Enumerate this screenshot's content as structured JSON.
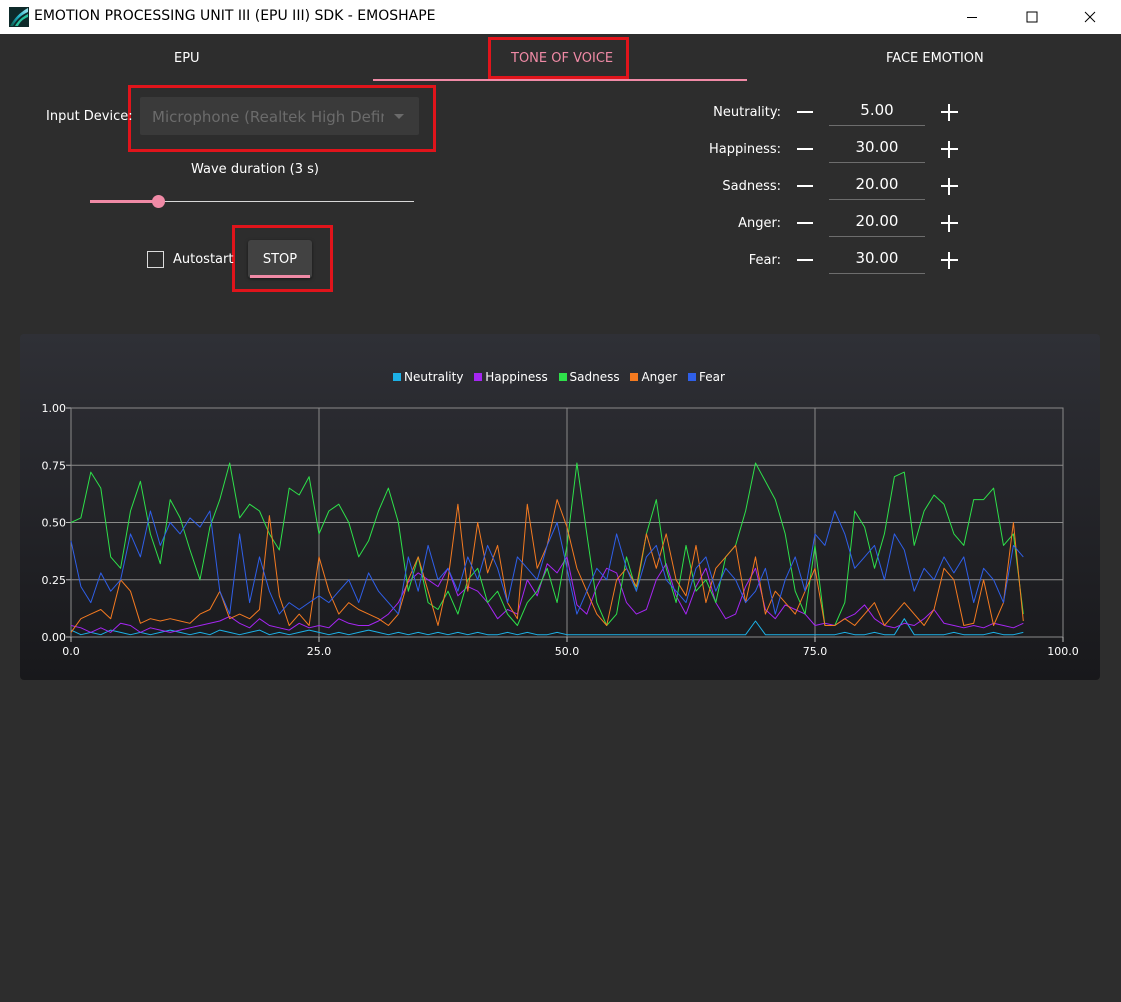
{
  "window": {
    "title": "EMOTION PROCESSING UNIT III (EPU III) SDK - EMOSHAPE"
  },
  "tabs": [
    {
      "label": "EPU",
      "active": false
    },
    {
      "label": "TONE OF VOICE",
      "active": true
    },
    {
      "label": "FACE EMOTION",
      "active": false
    }
  ],
  "controls": {
    "input_device_label": "Input Device:",
    "input_device_value": "Microphone (Realtek High Definition Audio)",
    "wave_duration_label": "Wave duration (3 s)",
    "wave_duration_fraction": 0.21,
    "autostart_label": "Autostart",
    "autostart_checked": false,
    "stop_label": "STOP"
  },
  "emotions": [
    {
      "label": "Neutrality:",
      "value": "5.00"
    },
    {
      "label": "Happiness:",
      "value": "30.00"
    },
    {
      "label": "Sadness:",
      "value": "20.00"
    },
    {
      "label": "Anger:",
      "value": "20.00"
    },
    {
      "label": "Fear:",
      "value": "30.00"
    }
  ],
  "colors": {
    "accent": "#f08aa6",
    "highlight_box": "#e0141b",
    "background": "#2d2d2d"
  },
  "chart_data": {
    "type": "line",
    "title": "",
    "xlabel": "",
    "ylabel": "",
    "xlim": [
      0,
      100
    ],
    "ylim": [
      0,
      1
    ],
    "x_ticks": [
      "0.0",
      "25.0",
      "50.0",
      "75.0",
      "100.0"
    ],
    "y_ticks": [
      "0.00",
      "0.25",
      "0.50",
      "0.75",
      "1.00"
    ],
    "grid": true,
    "legend_position": "top-center",
    "x": [
      0,
      1,
      2,
      3,
      4,
      5,
      6,
      7,
      8,
      9,
      10,
      11,
      12,
      13,
      14,
      15,
      16,
      17,
      18,
      19,
      20,
      21,
      22,
      23,
      24,
      25,
      26,
      27,
      28,
      29,
      30,
      31,
      32,
      33,
      34,
      35,
      36,
      37,
      38,
      39,
      40,
      41,
      42,
      43,
      44,
      45,
      46,
      47,
      48,
      49,
      50,
      51,
      52,
      53,
      54,
      55,
      56,
      57,
      58,
      59,
      60,
      61,
      62,
      63,
      64,
      65,
      66,
      67,
      68,
      69,
      70,
      71,
      72,
      73,
      74,
      75,
      76,
      77,
      78,
      79,
      80,
      81,
      82,
      83,
      84,
      85,
      86,
      87,
      88,
      89,
      90,
      91,
      92,
      93,
      94,
      95,
      96
    ],
    "series": [
      {
        "name": "Neutrality",
        "color": "#1cb0e6",
        "values": [
          0.03,
          0.01,
          0.02,
          0.01,
          0.03,
          0.02,
          0.01,
          0.02,
          0.01,
          0.02,
          0.03,
          0.02,
          0.01,
          0.02,
          0.01,
          0.03,
          0.02,
          0.01,
          0.02,
          0.03,
          0.01,
          0.02,
          0.01,
          0.02,
          0.03,
          0.02,
          0.01,
          0.02,
          0.01,
          0.02,
          0.03,
          0.02,
          0.01,
          0.02,
          0.01,
          0.02,
          0.01,
          0.02,
          0.01,
          0.02,
          0.01,
          0.02,
          0.01,
          0.01,
          0.02,
          0.01,
          0.02,
          0.01,
          0.01,
          0.02,
          0.01,
          0.01,
          0.01,
          0.01,
          0.01,
          0.01,
          0.01,
          0.01,
          0.01,
          0.01,
          0.01,
          0.01,
          0.01,
          0.01,
          0.01,
          0.01,
          0.01,
          0.01,
          0.01,
          0.07,
          0.01,
          0.01,
          0.01,
          0.01,
          0.01,
          0.01,
          0.01,
          0.01,
          0.02,
          0.01,
          0.01,
          0.02,
          0.01,
          0.01,
          0.08,
          0.01,
          0.01,
          0.01,
          0.01,
          0.02,
          0.01,
          0.01,
          0.01,
          0.02,
          0.01,
          0.01,
          0.02
        ]
      },
      {
        "name": "Happiness",
        "color": "#a526f2",
        "values": [
          0.05,
          0.04,
          0.02,
          0.04,
          0.02,
          0.06,
          0.05,
          0.02,
          0.04,
          0.03,
          0.02,
          0.03,
          0.04,
          0.05,
          0.06,
          0.07,
          0.09,
          0.06,
          0.04,
          0.08,
          0.05,
          0.04,
          0.03,
          0.06,
          0.04,
          0.05,
          0.04,
          0.08,
          0.06,
          0.05,
          0.05,
          0.07,
          0.1,
          0.15,
          0.24,
          0.28,
          0.25,
          0.22,
          0.3,
          0.18,
          0.22,
          0.2,
          0.15,
          0.08,
          0.12,
          0.1,
          0.25,
          0.18,
          0.32,
          0.28,
          0.35,
          0.14,
          0.1,
          0.22,
          0.3,
          0.28,
          0.15,
          0.1,
          0.12,
          0.25,
          0.32,
          0.18,
          0.1,
          0.22,
          0.3,
          0.15,
          0.08,
          0.1,
          0.22,
          0.3,
          0.12,
          0.08,
          0.14,
          0.12,
          0.1,
          0.05,
          0.06,
          0.05,
          0.08,
          0.1,
          0.14,
          0.08,
          0.05,
          0.04,
          0.06,
          0.05,
          0.08,
          0.12,
          0.06,
          0.05,
          0.04,
          0.05,
          0.04,
          0.06,
          0.05,
          0.04,
          0.06
        ]
      },
      {
        "name": "Sadness",
        "color": "#2ee04a",
        "values": [
          0.5,
          0.52,
          0.72,
          0.65,
          0.35,
          0.3,
          0.55,
          0.68,
          0.45,
          0.32,
          0.6,
          0.52,
          0.38,
          0.25,
          0.48,
          0.6,
          0.76,
          0.52,
          0.58,
          0.55,
          0.45,
          0.38,
          0.65,
          0.62,
          0.7,
          0.45,
          0.55,
          0.58,
          0.5,
          0.35,
          0.42,
          0.55,
          0.65,
          0.5,
          0.2,
          0.35,
          0.15,
          0.12,
          0.2,
          0.1,
          0.25,
          0.3,
          0.15,
          0.2,
          0.1,
          0.05,
          0.15,
          0.2,
          0.3,
          0.15,
          0.4,
          0.76,
          0.45,
          0.15,
          0.05,
          0.1,
          0.35,
          0.2,
          0.45,
          0.6,
          0.3,
          0.15,
          0.4,
          0.2,
          0.25,
          0.15,
          0.35,
          0.4,
          0.55,
          0.76,
          0.68,
          0.6,
          0.45,
          0.2,
          0.1,
          0.4,
          0.05,
          0.05,
          0.15,
          0.55,
          0.48,
          0.3,
          0.45,
          0.7,
          0.72,
          0.4,
          0.55,
          0.62,
          0.58,
          0.45,
          0.4,
          0.6,
          0.6,
          0.65,
          0.4,
          0.45,
          0.1
        ]
      },
      {
        "name": "Anger",
        "color": "#f47a20",
        "values": [
          0.02,
          0.08,
          0.1,
          0.12,
          0.08,
          0.25,
          0.2,
          0.06,
          0.08,
          0.07,
          0.08,
          0.07,
          0.06,
          0.1,
          0.12,
          0.2,
          0.08,
          0.1,
          0.08,
          0.12,
          0.53,
          0.18,
          0.05,
          0.1,
          0.05,
          0.35,
          0.2,
          0.1,
          0.15,
          0.12,
          0.1,
          0.08,
          0.05,
          0.1,
          0.25,
          0.35,
          0.2,
          0.05,
          0.25,
          0.58,
          0.2,
          0.5,
          0.28,
          0.4,
          0.15,
          0.08,
          0.58,
          0.3,
          0.4,
          0.6,
          0.48,
          0.3,
          0.2,
          0.1,
          0.05,
          0.25,
          0.3,
          0.22,
          0.45,
          0.3,
          0.45,
          0.25,
          0.18,
          0.4,
          0.15,
          0.3,
          0.35,
          0.4,
          0.15,
          0.35,
          0.1,
          0.2,
          0.15,
          0.1,
          0.2,
          0.3,
          0.05,
          0.05,
          0.08,
          0.05,
          0.1,
          0.15,
          0.05,
          0.1,
          0.15,
          0.1,
          0.05,
          0.12,
          0.3,
          0.25,
          0.05,
          0.06,
          0.25,
          0.05,
          0.15,
          0.5,
          0.07
        ]
      },
      {
        "name": "Fear",
        "color": "#2f5fe8",
        "values": [
          0.42,
          0.22,
          0.15,
          0.28,
          0.2,
          0.25,
          0.45,
          0.35,
          0.55,
          0.4,
          0.5,
          0.45,
          0.52,
          0.48,
          0.55,
          0.2,
          0.1,
          0.45,
          0.15,
          0.35,
          0.2,
          0.1,
          0.15,
          0.12,
          0.15,
          0.18,
          0.15,
          0.2,
          0.25,
          0.15,
          0.28,
          0.2,
          0.15,
          0.1,
          0.35,
          0.2,
          0.4,
          0.25,
          0.3,
          0.2,
          0.35,
          0.25,
          0.4,
          0.3,
          0.15,
          0.35,
          0.3,
          0.25,
          0.4,
          0.5,
          0.3,
          0.1,
          0.2,
          0.3,
          0.25,
          0.45,
          0.3,
          0.2,
          0.35,
          0.4,
          0.25,
          0.2,
          0.15,
          0.3,
          0.35,
          0.2,
          0.3,
          0.25,
          0.15,
          0.2,
          0.3,
          0.1,
          0.25,
          0.35,
          0.2,
          0.45,
          0.4,
          0.55,
          0.45,
          0.3,
          0.35,
          0.4,
          0.25,
          0.45,
          0.38,
          0.2,
          0.3,
          0.25,
          0.35,
          0.28,
          0.35,
          0.15,
          0.3,
          0.25,
          0.15,
          0.4,
          0.35
        ]
      }
    ]
  }
}
